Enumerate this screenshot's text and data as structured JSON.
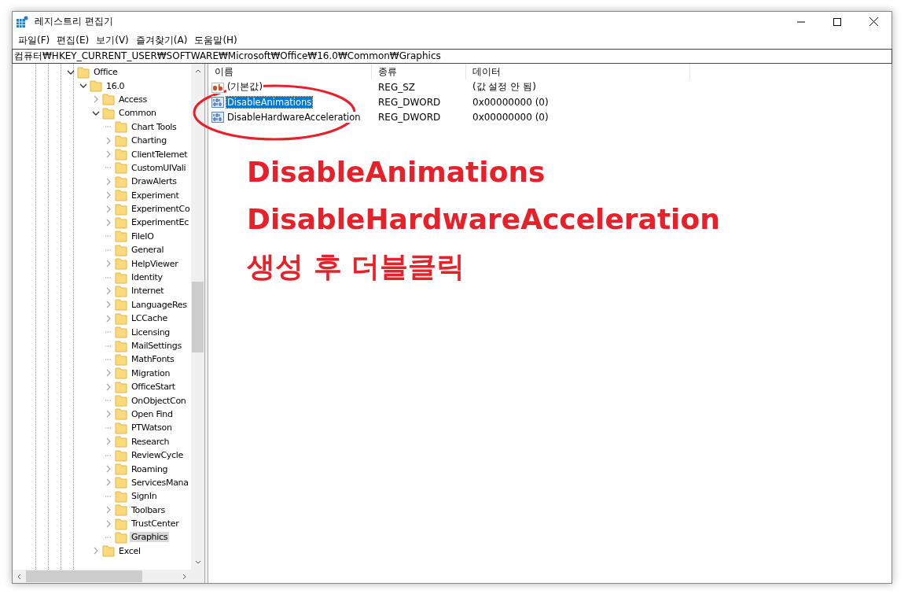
{
  "window": {
    "title": "레지스트리 편집기"
  },
  "menu": [
    "파일(F)",
    "편집(E)",
    "보기(V)",
    "즐겨찾기(A)",
    "도움말(H)"
  ],
  "address": "컴퓨터₩HKEY_CURRENT_USER₩SOFTWARE₩Microsoft₩Office₩16.0₩Common₩Graphics",
  "tree": [
    {
      "label": "Office",
      "kind": "branch",
      "expanded": true,
      "selected": false,
      "children": [
        {
          "label": "16.0",
          "kind": "branch",
          "expanded": true,
          "selected": false,
          "children": [
            {
              "label": "Access",
              "kind": "branch",
              "expanded": false,
              "selected": false
            },
            {
              "label": "Common",
              "kind": "branch",
              "expanded": true,
              "selected": false,
              "children": [
                {
                  "label": "Chart Tools",
                  "kind": "leaf",
                  "selected": false
                },
                {
                  "label": "Charting",
                  "kind": "branch",
                  "expanded": false,
                  "selected": false
                },
                {
                  "label": "ClientTelemet",
                  "kind": "branch",
                  "expanded": false,
                  "selected": false
                },
                {
                  "label": "CustomUIVali",
                  "kind": "leaf",
                  "selected": false
                },
                {
                  "label": "DrawAlerts",
                  "kind": "branch",
                  "expanded": false,
                  "selected": false
                },
                {
                  "label": "Experiment",
                  "kind": "branch",
                  "expanded": false,
                  "selected": false
                },
                {
                  "label": "ExperimentCo",
                  "kind": "branch",
                  "expanded": false,
                  "selected": false
                },
                {
                  "label": "ExperimentEc",
                  "kind": "branch",
                  "expanded": false,
                  "selected": false
                },
                {
                  "label": "FileIO",
                  "kind": "leaf",
                  "selected": false
                },
                {
                  "label": "General",
                  "kind": "leaf",
                  "selected": false
                },
                {
                  "label": "HelpViewer",
                  "kind": "branch",
                  "expanded": false,
                  "selected": false
                },
                {
                  "label": "Identity",
                  "kind": "leaf",
                  "selected": false
                },
                {
                  "label": "Internet",
                  "kind": "branch",
                  "expanded": false,
                  "selected": false
                },
                {
                  "label": "LanguageRes",
                  "kind": "branch",
                  "expanded": false,
                  "selected": false
                },
                {
                  "label": "LCCache",
                  "kind": "branch",
                  "expanded": false,
                  "selected": false
                },
                {
                  "label": "Licensing",
                  "kind": "leaf",
                  "selected": false
                },
                {
                  "label": "MailSettings",
                  "kind": "leaf",
                  "selected": false
                },
                {
                  "label": "MathFonts",
                  "kind": "leaf",
                  "selected": false
                },
                {
                  "label": "Migration",
                  "kind": "branch",
                  "expanded": false,
                  "selected": false
                },
                {
                  "label": "OfficeStart",
                  "kind": "branch",
                  "expanded": false,
                  "selected": false
                },
                {
                  "label": "OnObjectCon",
                  "kind": "leaf",
                  "selected": false
                },
                {
                  "label": "Open Find",
                  "kind": "branch",
                  "expanded": false,
                  "selected": false
                },
                {
                  "label": "PTWatson",
                  "kind": "leaf",
                  "selected": false
                },
                {
                  "label": "Research",
                  "kind": "branch",
                  "expanded": false,
                  "selected": false
                },
                {
                  "label": "ReviewCycle",
                  "kind": "leaf",
                  "selected": false
                },
                {
                  "label": "Roaming",
                  "kind": "branch",
                  "expanded": false,
                  "selected": false
                },
                {
                  "label": "ServicesMana",
                  "kind": "branch",
                  "expanded": false,
                  "selected": false
                },
                {
                  "label": "SignIn",
                  "kind": "leaf",
                  "selected": false
                },
                {
                  "label": "Toolbars",
                  "kind": "branch",
                  "expanded": false,
                  "selected": false
                },
                {
                  "label": "TrustCenter",
                  "kind": "branch",
                  "expanded": false,
                  "selected": false
                },
                {
                  "label": "Graphics",
                  "kind": "leaf",
                  "selected": true
                }
              ]
            },
            {
              "label": "Excel",
              "kind": "branch",
              "expanded": false,
              "selected": false
            }
          ]
        }
      ]
    }
  ],
  "table": {
    "columns": [
      "이름",
      "종류",
      "데이터"
    ],
    "rows": [
      {
        "kind": "string",
        "name": "(기본값)",
        "type": "REG_SZ",
        "data": "(값 설정 안 됨)",
        "selected": false
      },
      {
        "kind": "binary",
        "name": "DisableAnimations",
        "type": "REG_DWORD",
        "data": "0x00000000 (0)",
        "selected": true
      },
      {
        "kind": "binary",
        "name": "DisableHardwareAcceleration",
        "type": "REG_DWORD",
        "data": "0x00000000 (0)",
        "selected": false
      }
    ]
  },
  "annotation": {
    "lines": [
      "DisableAnimations",
      "DisableHardwareAcceleration",
      "생성 후 더블클릭"
    ]
  }
}
